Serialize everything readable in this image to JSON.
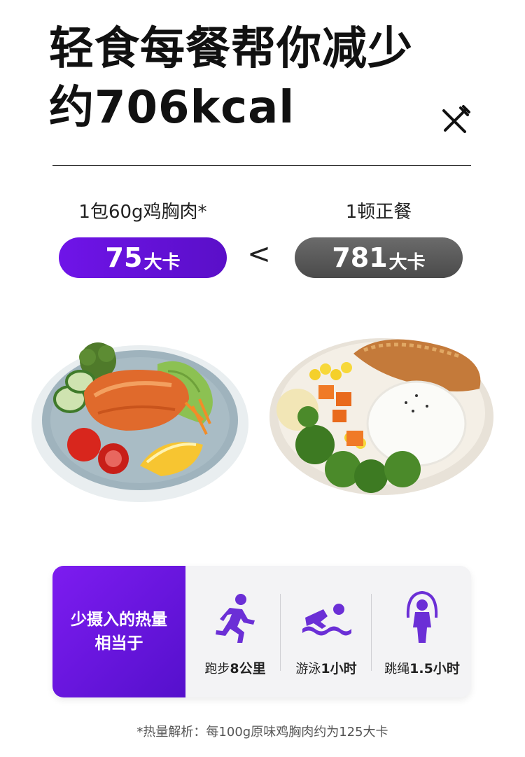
{
  "headline": {
    "line1": "轻食每餐帮你减少",
    "line2": "约706kcal"
  },
  "comparison": {
    "left": {
      "label": "1包60g鸡胸肉*",
      "value": "75",
      "unit": "大卡"
    },
    "symbol": "<",
    "right": {
      "label": "1顿正餐",
      "value": "781",
      "unit": "大卡"
    }
  },
  "images": {
    "left": "chicken-breast-salad-plate",
    "right": "rice-cutlet-vegetable-plate"
  },
  "equivalent": {
    "title_line1": "少摄入的热量",
    "title_line2": "相当于",
    "activities": [
      {
        "icon": "running-icon",
        "prefix": "跑步",
        "value": "8公里"
      },
      {
        "icon": "swimming-icon",
        "prefix": "游泳",
        "value": "1小时"
      },
      {
        "icon": "jump-rope-icon",
        "prefix": "跳绳",
        "value": "1.5小时"
      }
    ]
  },
  "footnote": "*热量解析：每100g原味鸡胸肉约为125大卡",
  "colors": {
    "accent": "#6f14e8",
    "gray_pill": "#5a5a5a"
  }
}
